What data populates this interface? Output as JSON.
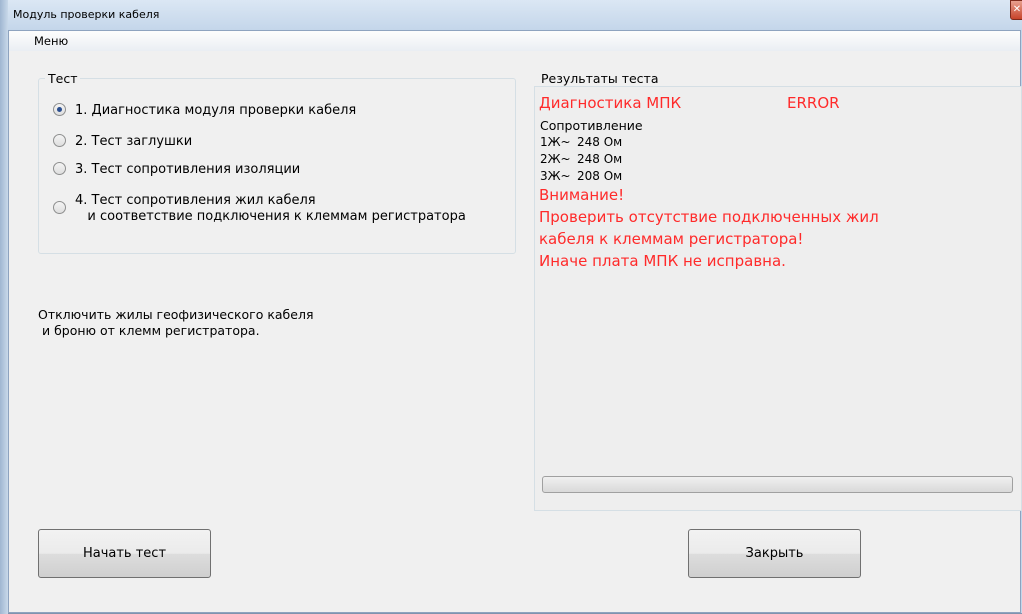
{
  "window": {
    "title": "Модуль проверки кабеля"
  },
  "menu": {
    "items": [
      "Меню"
    ]
  },
  "test_group": {
    "legend": "Тест",
    "options": [
      {
        "label": "1. Диагностика модуля проверки кабеля",
        "checked": true
      },
      {
        "label": "2. Тест заглушки",
        "checked": false
      },
      {
        "label": "3. Тест сопротивления изоляции",
        "checked": false
      },
      {
        "label": "4. Тест сопротивления жил кабеля\n   и соответствие подключения к клеммам регистратора",
        "checked": false
      }
    ]
  },
  "instruction": "Отключить жилы геофизического кабеля\n и броню от клемм регистратора.",
  "results": {
    "legend": "Результаты теста",
    "diag_label": "Диагностика МПК",
    "status": "ERROR",
    "resistance_title": "Сопротивление",
    "rows": [
      {
        "core": "1Ж~",
        "value": "248 Ом"
      },
      {
        "core": "2Ж~",
        "value": "248 Ом"
      },
      {
        "core": "3Ж~",
        "value": "208 Ом"
      }
    ],
    "warning_lines": [
      "Внимание!",
      "Проверить отсутствие подключенных жил",
      "кабеля к клеммам регистратора!",
      "Иначе плата МПК не исправна."
    ],
    "progress": 0
  },
  "buttons": {
    "start": "Начать тест",
    "close": "Закрыть"
  },
  "colors": {
    "error_text": "#ff2a2a",
    "background": "#f0f0f0"
  }
}
